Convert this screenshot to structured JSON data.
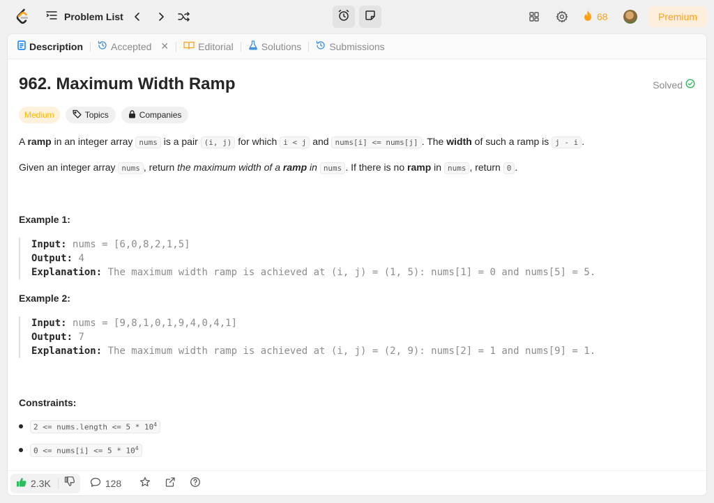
{
  "topbar": {
    "problem_list_label": "Problem List",
    "streak_count": "68",
    "premium_label": "Premium"
  },
  "tabs": [
    {
      "label": "Description"
    },
    {
      "label": "Accepted"
    },
    {
      "label": "Editorial"
    },
    {
      "label": "Solutions"
    },
    {
      "label": "Submissions"
    }
  ],
  "problem": {
    "title": "962. Maximum Width Ramp",
    "status": "Solved",
    "difficulty": "Medium",
    "topics_label": "Topics",
    "companies_label": "Companies"
  },
  "description": {
    "p1": {
      "t1": "A ",
      "b1": "ramp",
      "t2": " in an integer array ",
      "c1": "nums",
      "t3": " is a pair ",
      "c2": "(i, j)",
      "t4": " for which ",
      "c3": "i < j",
      "t5": " and ",
      "c4": "nums[i] <= nums[j]",
      "t6": ". The ",
      "b2": "width",
      "t7": " of such a ramp is ",
      "c5": "j - i",
      "t8": "."
    },
    "p2": {
      "t1": "Given an integer array ",
      "c1": "nums",
      "t2": ", return ",
      "i1": "the maximum width of a ",
      "ib1": "ramp",
      "i2": " in ",
      "c2": "nums",
      "t3": ". If there is no ",
      "b1": "ramp",
      "t4": " in ",
      "c3": "nums",
      "t5": ", return ",
      "c4": "0",
      "t6": "."
    }
  },
  "examples": [
    {
      "heading": "Example 1:",
      "input_label": "Input:",
      "input": "nums = [6,0,8,2,1,5]",
      "output_label": "Output:",
      "output": "4",
      "explanation_label": "Explanation:",
      "explanation": "The maximum width ramp is achieved at (i, j) = (1, 5): nums[1] = 0 and nums[5] = 5."
    },
    {
      "heading": "Example 2:",
      "input_label": "Input:",
      "input": "nums = [9,8,1,0,1,9,4,0,4,1]",
      "output_label": "Output:",
      "output": "7",
      "explanation_label": "Explanation:",
      "explanation": "The maximum width ramp is achieved at (i, j) = (2, 9): nums[2] = 1 and nums[9] = 1."
    }
  ],
  "constraints": {
    "heading": "Constraints:",
    "items": [
      {
        "text": "2 <= nums.length <= 5 * 10",
        "sup": "4"
      },
      {
        "text": "0 <= nums[i] <= 5 * 10",
        "sup": "4"
      }
    ]
  },
  "footer": {
    "likes": "2.3K",
    "comments": "128"
  },
  "colors": {
    "accent": "#ffa116",
    "solved": "#2cbb5d",
    "like": "#2cbb5d"
  }
}
